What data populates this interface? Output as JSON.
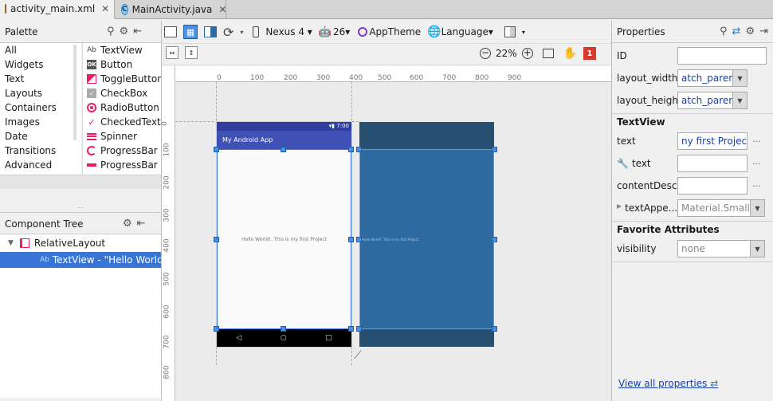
{
  "tabs": [
    {
      "label": "activity_main.xml",
      "icon": "xml-file-icon"
    },
    {
      "label": "MainActivity.java",
      "icon": "java-class-icon"
    }
  ],
  "palette": {
    "title": "Palette",
    "categories": [
      "All",
      "Widgets",
      "Text",
      "Layouts",
      "Containers",
      "Images",
      "Date",
      "Transitions",
      "Advanced"
    ],
    "widgets": [
      {
        "label": "TextView",
        "icon": "textview-icon"
      },
      {
        "label": "Button",
        "icon": "button-icon"
      },
      {
        "label": "ToggleButton",
        "icon": "toggle-icon"
      },
      {
        "label": "CheckBox",
        "icon": "checkbox-icon"
      },
      {
        "label": "RadioButton",
        "icon": "radio-icon"
      },
      {
        "label": "CheckedTextView",
        "icon": "checked-text-icon"
      },
      {
        "label": "Spinner",
        "icon": "spinner-icon"
      },
      {
        "label": "ProgressBar",
        "icon": "progress-circle-icon"
      },
      {
        "label": "ProgressBar",
        "icon": "progress-bar-icon"
      }
    ]
  },
  "tree": {
    "title": "Component Tree",
    "root": "RelativeLayout",
    "child": "TextView - \"Hello World!. This is my first Project\""
  },
  "toolbar": {
    "device": "Nexus 4",
    "api": "26",
    "theme": "AppTheme",
    "language": "Language",
    "zoom": "22%",
    "error_count": "1"
  },
  "ruler": {
    "h": [
      "0",
      "100",
      "200",
      "300",
      "400",
      "500",
      "600",
      "700",
      "800",
      "900"
    ],
    "v": [
      "0",
      "100",
      "200",
      "300",
      "400",
      "500",
      "600",
      "700",
      "800"
    ]
  },
  "phone": {
    "time": "7:00",
    "app_title": "My Android App",
    "hello": "Hello World!. This is my first Project",
    "blueprint_hello": "Hello World!. This is my first Project"
  },
  "props": {
    "title": "Properties",
    "id_label": "ID",
    "id_value": "",
    "lw_label": "layout_width",
    "lw_value": "atch_parent",
    "lh_label": "layout_height",
    "lh_value": "atch_parent",
    "textview_hdr": "TextView",
    "text_label": "text",
    "text_value": "ny first Project",
    "tools_text_label": "text",
    "cd_label": "contentDesc...",
    "ta_label": "textAppe...",
    "ta_value": "Material.Small",
    "fav_hdr": "Favorite Attributes",
    "vis_label": "visibility",
    "vis_value": "none",
    "view_all": "View all properties"
  },
  "colors": {
    "selection": "#3875d7",
    "blueprint": "#2d6a9f",
    "blueprint_dark": "#274f72",
    "appbar": "#3f51b5",
    "statusbar": "#303f9f"
  }
}
